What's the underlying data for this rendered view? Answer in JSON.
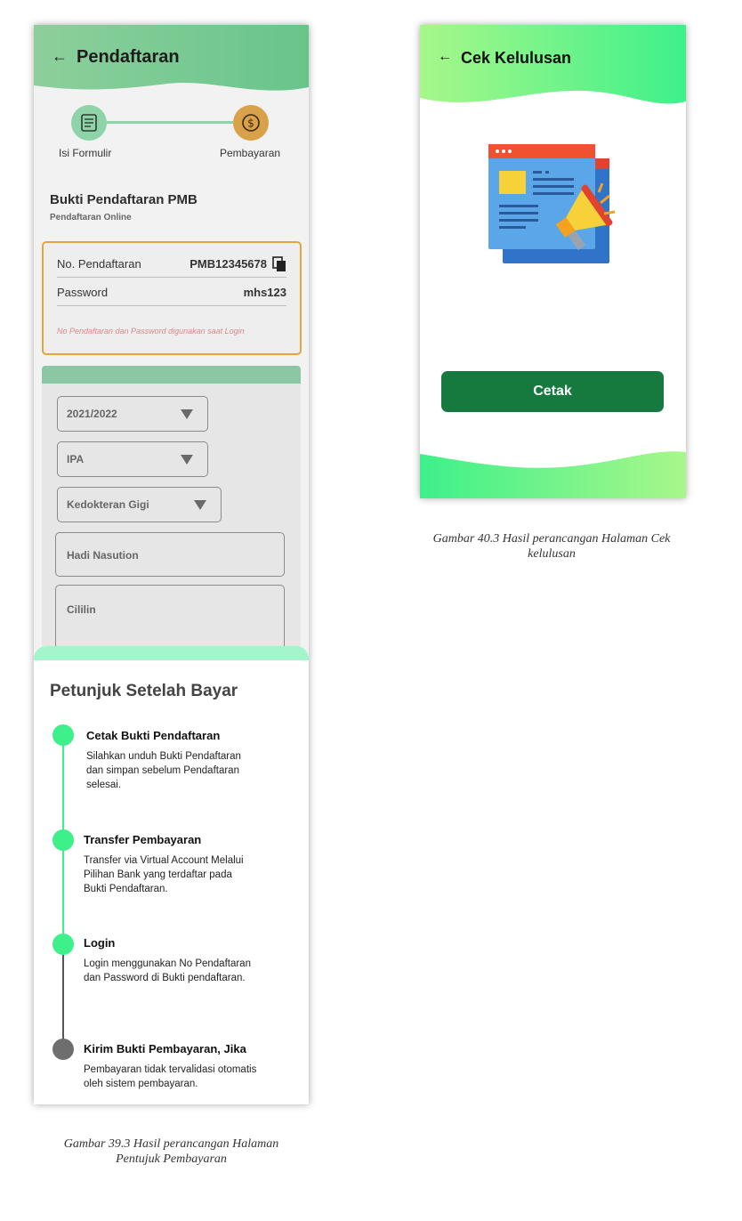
{
  "left_screen": {
    "header": {
      "back_icon": "←",
      "title": "Pendaftaran"
    },
    "stepper": {
      "steps": [
        {
          "label": "Isi Formulir",
          "icon": "form-icon"
        },
        {
          "label": "Pembayaran",
          "icon": "dollar-icon"
        }
      ]
    },
    "bukti": {
      "title": "Bukti Pendaftaran PMB",
      "subtitle": "Pendaftaran Online"
    },
    "credentials": {
      "no_label": "No. Pendaftaran",
      "no_value": "PMB12345678",
      "password_label": "Password",
      "password_value": "mhs123",
      "note": "No Pendaftaran dan Password digunakan saat Login"
    },
    "form": {
      "tahun": "2021/2022",
      "jurusan": "IPA",
      "prodi": "Kedokteran Gigi",
      "nama": "Hadi Nasution",
      "alamat": "Cililin"
    },
    "instructions": {
      "title": "Petunjuk Setelah Bayar",
      "steps": [
        {
          "title": "Cetak Bukti Pendaftaran",
          "desc": [
            "Silahkan unduh Bukti Pendaftaran",
            "dan simpan sebelum Pendaftaran",
            "selesai."
          ],
          "status": "done"
        },
        {
          "title": "Transfer Pembayaran",
          "desc": [
            "Transfer via Virtual Account Melalui",
            "Pilihan Bank yang terdaftar pada",
            "Bukti Pendaftaran."
          ],
          "status": "done"
        },
        {
          "title": "Login",
          "desc": [
            "Login menggunakan No Pendaftaran",
            "dan Password di Bukti pendaftaran."
          ],
          "status": "done"
        },
        {
          "title": "Kirim Bukti Pembayaran, Jika",
          "desc": [
            "Pembayaran tidak tervalidasi otomatis",
            "oleh sistem pembayaran."
          ],
          "status": "pending"
        }
      ]
    },
    "caption": [
      "Gambar 39.3 Hasil perancangan Halaman",
      "Pentujuk Pembayaran"
    ]
  },
  "right_screen": {
    "header": {
      "back_icon": "←",
      "title": "Cek Kelulusan"
    },
    "illustration": "announcement-document-megaphone-icon",
    "button_label": "Cetak",
    "caption": [
      "Gambar 40.3 Hasil perancangan Halaman Cek",
      "kelulusan"
    ]
  },
  "colors": {
    "accent_green": "#3ef08a",
    "button_green": "#167a3f",
    "payment_orange": "#d9a24a",
    "credential_border": "#e3a63c"
  }
}
